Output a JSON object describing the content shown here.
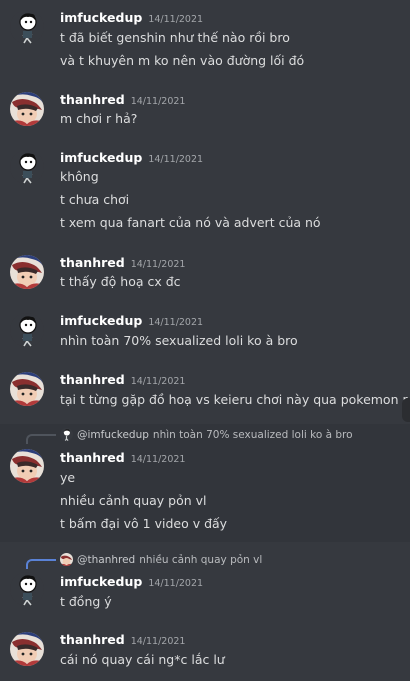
{
  "users": {
    "a": "imfuckedup",
    "b": "thanhred"
  },
  "messages": [
    {
      "author": "imfuckedup",
      "time": "14/11/2021",
      "lines": [
        "t đã biết genshin như thế nào rồi bro",
        "và t khuyên m ko nên vào đường lối đó"
      ]
    },
    {
      "author": "thanhred",
      "time": "14/11/2021",
      "lines": [
        "m chơi r hả?"
      ]
    },
    {
      "author": "imfuckedup",
      "time": "14/11/2021",
      "lines": [
        "không",
        "t chưa chơi",
        "t xem qua fanart của nó và advert của nó"
      ]
    },
    {
      "author": "thanhred",
      "time": "14/11/2021",
      "lines": [
        "t thấy độ hoạ cx đc"
      ]
    },
    {
      "author": "imfuckedup",
      "time": "14/11/2021",
      "lines": [
        "nhìn toàn 70% sexualized loli ko à bro"
      ]
    },
    {
      "author": "thanhred",
      "time": "14/11/2021",
      "lines": [
        "tại t từng gặp đồ hoạ vs keieru chơi này qua pokemon r"
      ]
    },
    {
      "author": "thanhred",
      "time": "14/11/2021",
      "reply": {
        "name": "@imfuckedup",
        "text": "nhìn toàn 70% sexualized loli ko à bro"
      },
      "lines": [
        "ye",
        "nhiều cảnh quay pỏn vl",
        "t bấm đại vô 1 video v đấy"
      ]
    },
    {
      "author": "imfuckedup",
      "time": "14/11/2021",
      "reply": {
        "name": "@thanhred",
        "text": "nhiều cảnh quay pỏn vl"
      },
      "lines": [
        "t đồng ý"
      ]
    },
    {
      "author": "thanhred",
      "time": "14/11/2021",
      "lines": [
        "cái nó quay cái ng*c lắc lư"
      ]
    }
  ],
  "colors": {
    "background": "#36393f",
    "username": "#ffffff",
    "timestamp": "#a3a6aa",
    "text": "#dcddde",
    "reply_spine_mention": "#5a82d6"
  },
  "icons": {
    "avatar_a": "stick-figure-avatar",
    "avatar_b": "anime-character-avatar"
  }
}
